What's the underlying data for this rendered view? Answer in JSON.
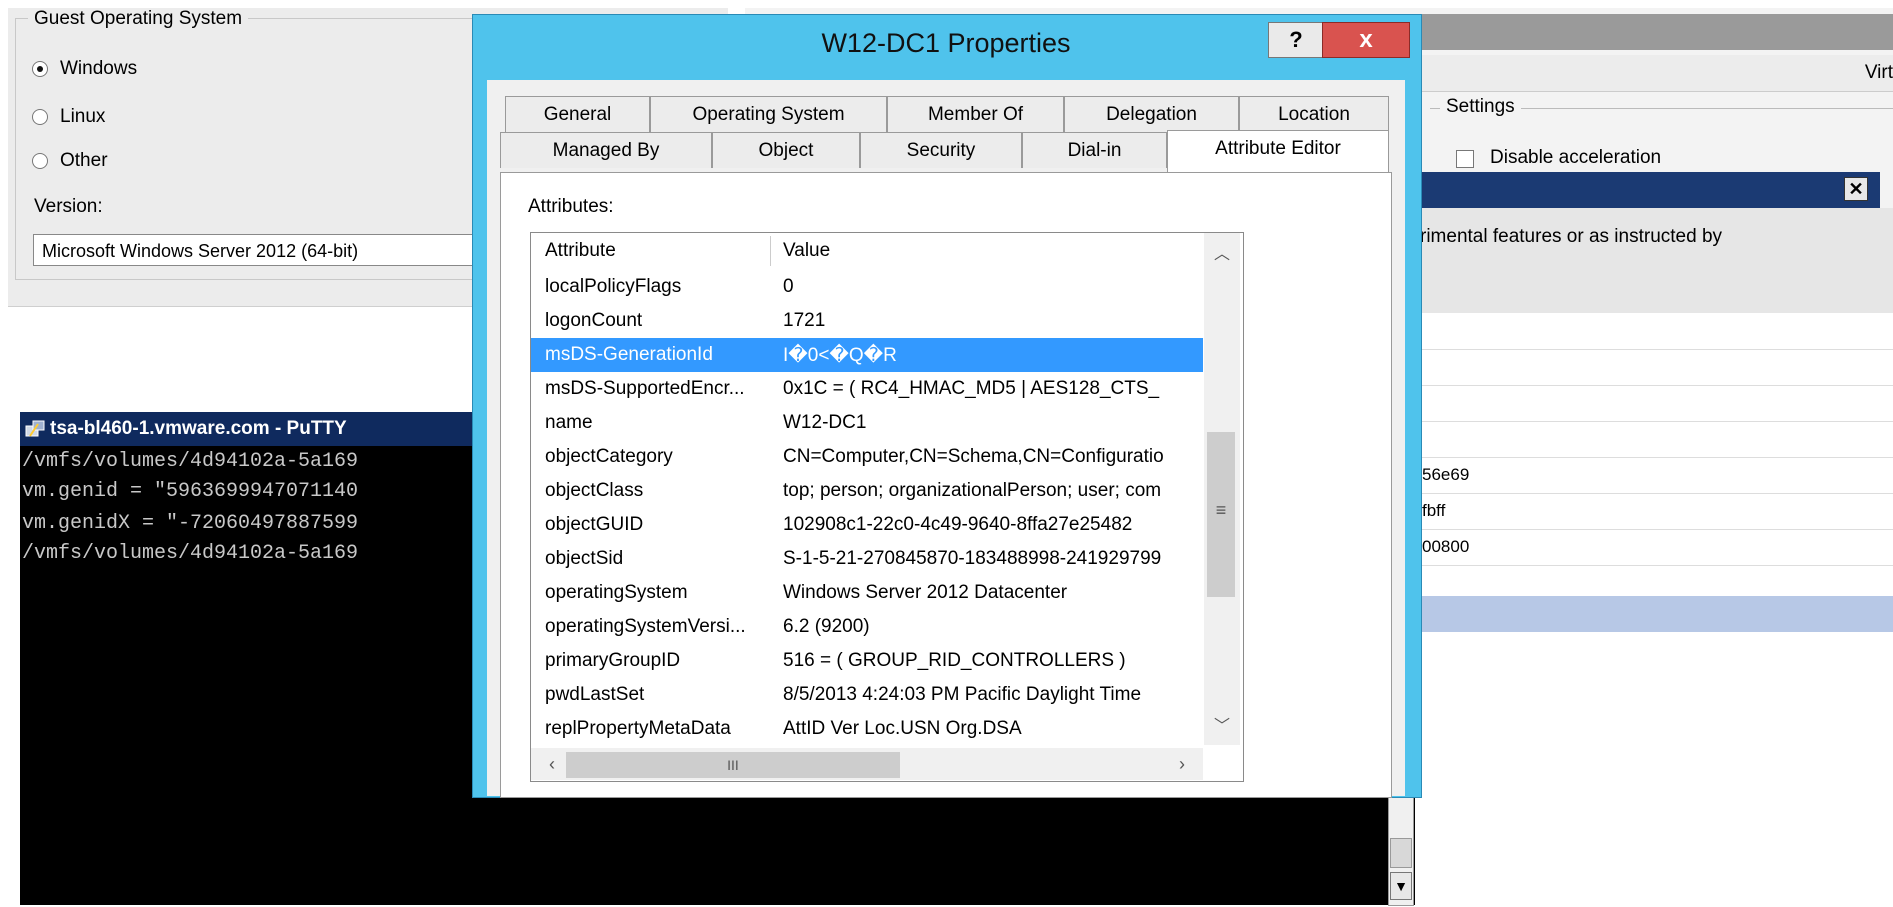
{
  "guest_os": {
    "group_title": "Guest Operating System",
    "options": [
      "Windows",
      "Linux",
      "Other"
    ],
    "selected": "Windows",
    "version_label": "Version:",
    "version_value": "Microsoft Windows Server 2012 (64-bit)"
  },
  "right_window": {
    "header_text": "Virt",
    "settings_title": "Settings",
    "disable_label": "Disable acceleration",
    "dialog_text": "rimental features or as instructed by",
    "list_values": [
      "56e69",
      "fbff",
      "00800"
    ]
  },
  "putty": {
    "title": "tsa-bl460-1.vmware.com - PuTTY",
    "lines": [
      "/vmfs/volumes/4d94102a-5a169",
      "vm.genid = \"5963699947071140",
      "vm.genidX = \"-72060497887599",
      "/vmfs/volumes/4d94102a-5a169"
    ]
  },
  "dialog": {
    "title": "W12-DC1 Properties",
    "help_label": "?",
    "close_label": "x",
    "tabs_row1": [
      "General",
      "Operating System",
      "Member Of",
      "Delegation",
      "Location"
    ],
    "tabs_row2": [
      "Managed By",
      "Object",
      "Security",
      "Dial-in",
      "Attribute Editor"
    ],
    "active_tab": "Attribute Editor",
    "attributes_label": "Attributes:",
    "columns": [
      "Attribute",
      "Value"
    ],
    "rows": [
      {
        "attribute": "localPolicyFlags",
        "value": "0"
      },
      {
        "attribute": "logonCount",
        "value": "1721"
      },
      {
        "attribute": "msDS-GenerationId",
        "value": "I�0<�Q�R"
      },
      {
        "attribute": "msDS-SupportedEncr...",
        "value": "0x1C = ( RC4_HMAC_MD5 | AES128_CTS_"
      },
      {
        "attribute": "name",
        "value": "W12-DC1"
      },
      {
        "attribute": "objectCategory",
        "value": "CN=Computer,CN=Schema,CN=Configuratio"
      },
      {
        "attribute": "objectClass",
        "value": "top; person; organizationalPerson; user; com"
      },
      {
        "attribute": "objectGUID",
        "value": "102908c1-22c0-4c49-9640-8ffa27e25482"
      },
      {
        "attribute": "objectSid",
        "value": "S-1-5-21-270845870-183488998-241929799"
      },
      {
        "attribute": "operatingSystem",
        "value": "Windows Server 2012 Datacenter"
      },
      {
        "attribute": "operatingSystemVersi...",
        "value": "6.2 (9200)"
      },
      {
        "attribute": "primaryGroupID",
        "value": "516 = ( GROUP_RID_CONTROLLERS )"
      },
      {
        "attribute": "pwdLastSet",
        "value": "8/5/2013 4:24:03 PM Pacific Daylight Time"
      },
      {
        "attribute": "replPropertyMetaData",
        "value": "AttID  Ver   Loc.USN              Org.DSA"
      }
    ],
    "selected_row": "msDS-GenerationId",
    "hscroll_grip": "III",
    "vscroll_grip": "≡"
  },
  "colors": {
    "dialog_frame": "#4fc3ec",
    "selection": "#3399ff",
    "putty_bg": "#000000",
    "close_button": "#d9534f"
  }
}
